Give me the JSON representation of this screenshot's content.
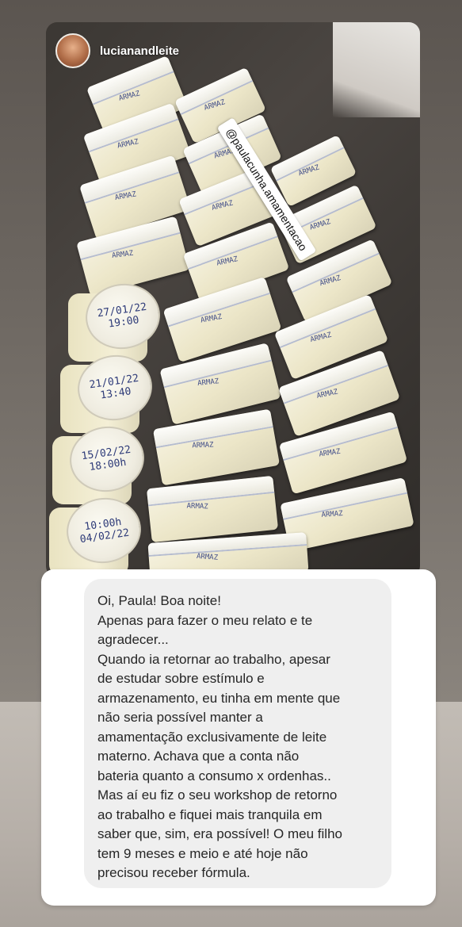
{
  "story": {
    "username": "lucianandleite",
    "mention_sticker": "@paulacunha.amamentacao",
    "jar_labels": [
      [
        "27/01/22",
        "19:00"
      ],
      [
        "21/01/22",
        "13:40"
      ],
      [
        "15/02/22",
        "18:00h"
      ],
      [
        "10:00h",
        "04/02/22"
      ]
    ]
  },
  "message": {
    "lines": [
      "Oi, Paula! Boa noite!",
      "Apenas para fazer o meu relato e te",
      "agradecer...",
      "Quando ia retornar ao trabalho, apesar",
      "de estudar sobre estímulo e",
      "armazenamento, eu tinha em mente que",
      "não seria possível manter a",
      "amamentação exclusivamente de leite",
      "materno. Achava que a conta não",
      "bateria quanto a consumo x ordenhas..",
      "Mas aí eu fiz o seu workshop de retorno",
      "ao trabalho e fiquei mais tranquila em",
      "saber que, sim, era possível! O meu filho",
      "tem 9 meses e meio e até hoje não",
      "precisou receber fórmula."
    ]
  }
}
